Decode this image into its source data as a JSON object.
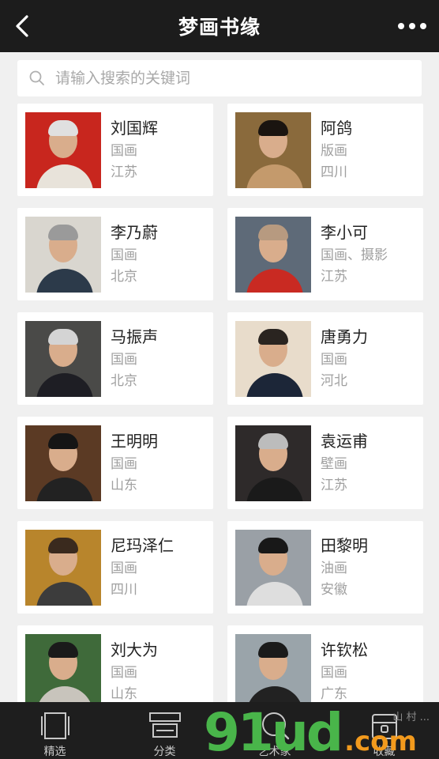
{
  "header": {
    "title": "梦画书缘"
  },
  "search": {
    "placeholder": "请输入搜索的关键词"
  },
  "artists": [
    {
      "name": "刘国辉",
      "genre": "国画",
      "region": "江苏",
      "photo": {
        "bg": "#c8261e",
        "torso": "#e8e3da",
        "hair": "#e0e0e0"
      }
    },
    {
      "name": "阿鸽",
      "genre": "版画",
      "region": "四川",
      "photo": {
        "bg": "#8a6a3c",
        "torso": "#c49a6c",
        "hair": "#1a1410"
      }
    },
    {
      "name": "李乃蔚",
      "genre": "国画",
      "region": "北京",
      "photo": {
        "bg": "#d9d6cf",
        "torso": "#2c3a4a",
        "hair": "#9a9a9a"
      }
    },
    {
      "name": "李小可",
      "genre": "国画、摄影",
      "region": "江苏",
      "photo": {
        "bg": "#5e6a78",
        "torso": "#c92a22",
        "hair": "#b79a80"
      }
    },
    {
      "name": "马振声",
      "genre": "国画",
      "region": "北京",
      "photo": {
        "bg": "#4a4a48",
        "torso": "#1e1e24",
        "hair": "#d4d4d4"
      }
    },
    {
      "name": "唐勇力",
      "genre": "国画",
      "region": "河北",
      "photo": {
        "bg": "#e8dccb",
        "torso": "#1c2638",
        "hair": "#2a2420"
      }
    },
    {
      "name": "王明明",
      "genre": "国画",
      "region": "山东",
      "photo": {
        "bg": "#5b3a24",
        "torso": "#222222",
        "hair": "#151515"
      }
    },
    {
      "name": "袁运甫",
      "genre": "壁画",
      "region": "江苏",
      "photo": {
        "bg": "#2e2a2a",
        "torso": "#1a1a1a",
        "hair": "#bcbcbc"
      }
    },
    {
      "name": "尼玛泽仁",
      "genre": "国画",
      "region": "四川",
      "photo": {
        "bg": "#b8852c",
        "torso": "#3c3c3c",
        "hair": "#3a2a1e"
      }
    },
    {
      "name": "田黎明",
      "genre": "油画",
      "region": "安徽",
      "photo": {
        "bg": "#9aa0a6",
        "torso": "#dedede",
        "hair": "#181818"
      }
    },
    {
      "name": "刘大为",
      "genre": "国画",
      "region": "山东",
      "photo": {
        "bg": "#3f6a3a",
        "torso": "#c8c4bc",
        "hair": "#1a1a1a"
      }
    },
    {
      "name": "许钦松",
      "genre": "国画",
      "region": "广东",
      "photo": {
        "bg": "#9aa4aa",
        "torso": "#222222",
        "hair": "#1a1a1a"
      }
    }
  ],
  "tabs": [
    {
      "label": "精选",
      "icon": "featured-icon"
    },
    {
      "label": "分类",
      "icon": "category-icon"
    },
    {
      "label": "艺术家",
      "icon": "artist-search-icon"
    },
    {
      "label": "收藏",
      "icon": "collection-icon"
    }
  ],
  "watermark": {
    "main": "91ud",
    "suffix": ".com",
    "small": "山 村 ..."
  }
}
